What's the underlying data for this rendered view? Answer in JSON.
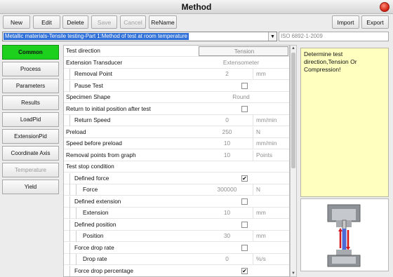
{
  "window": {
    "title": "Method"
  },
  "toolbar": {
    "new": "New",
    "edit": "Edit",
    "delete": "Delete",
    "save": "Save",
    "cancel": "Cancel",
    "rename": "ReName",
    "import": "Import",
    "export": "Export"
  },
  "method_select": {
    "value": "Metallic materials-Tensile testing-Part 1:Method of test at room temperature"
  },
  "standard": "ISO 6892-1-2009",
  "tabs": [
    {
      "label": "Common",
      "state": "active"
    },
    {
      "label": "Process"
    },
    {
      "label": "Parameters"
    },
    {
      "label": "Results"
    },
    {
      "label": "LoadPid"
    },
    {
      "label": "ExtensionPid"
    },
    {
      "label": "Coordinate Axis"
    },
    {
      "label": "Temperature",
      "state": "disabled"
    },
    {
      "label": "Yield"
    }
  ],
  "params": [
    {
      "label": "Test direction",
      "value": "Tension",
      "type": "select",
      "indent": 0
    },
    {
      "label": "Extension Transducer",
      "value": "Extensometer",
      "indent": 0
    },
    {
      "label": "Removal Point",
      "value": "2",
      "unit": "mm",
      "indent": 1
    },
    {
      "label": "Pause Test",
      "type": "check",
      "checked": false,
      "indent": 1
    },
    {
      "label": "Specimen Shape",
      "value": "Round",
      "indent": 0
    },
    {
      "label": "Return to initial position after test",
      "type": "check",
      "checked": false,
      "indent": 0
    },
    {
      "label": "Return Speed",
      "value": "0",
      "unit": "mm/min",
      "indent": 1
    },
    {
      "label": "Preload",
      "value": "250",
      "unit": "N",
      "indent": 0
    },
    {
      "label": "Speed before preload",
      "value": "10",
      "unit": "mm/min",
      "indent": 0
    },
    {
      "label": "Removal points from graph",
      "value": "10",
      "unit": "Points",
      "indent": 0
    },
    {
      "label": "Test stop condition",
      "indent": 0,
      "type": "header"
    },
    {
      "label": "Defined force",
      "type": "check",
      "checked": true,
      "indent": 1
    },
    {
      "label": "Force",
      "value": "300000",
      "unit": "N",
      "indent": 2
    },
    {
      "label": "Defined extension",
      "type": "check",
      "checked": false,
      "indent": 1
    },
    {
      "label": "Extension",
      "value": "10",
      "unit": "mm",
      "indent": 2
    },
    {
      "label": "Defined position",
      "type": "check",
      "checked": false,
      "indent": 1
    },
    {
      "label": "Position",
      "value": "30",
      "unit": "mm",
      "indent": 2
    },
    {
      "label": "Force drop rate",
      "type": "check",
      "checked": false,
      "indent": 1
    },
    {
      "label": "Drop rate",
      "value": "0",
      "unit": "%/s",
      "indent": 2
    },
    {
      "label": "Force drop percentage",
      "type": "check",
      "checked": true,
      "indent": 1
    }
  ],
  "help_text": "Determine test direction,Tension Or Compression!",
  "icons": {
    "combo_arrow": "chevron-down-icon",
    "close": "close-icon",
    "preview": "tensile-specimen-image"
  }
}
